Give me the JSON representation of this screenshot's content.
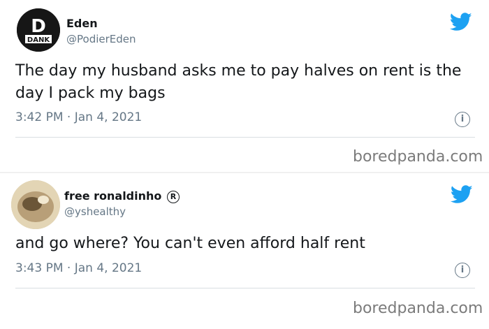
{
  "tweets": [
    {
      "display_name": "Eden",
      "handle": "@PodierEden",
      "avatar_logo": "D",
      "avatar_sub": "DANK",
      "text": "The day my husband asks me to pay halves on rent is the day I pack my bags",
      "timestamp": "3:42 PM · Jan 4, 2021",
      "watermark": "boredpanda.com"
    },
    {
      "display_name": "free ronaldinho",
      "handle": "@yshealthy",
      "text": "and go where? You can't even afford half rent",
      "timestamp": "3:43 PM · Jan 4, 2021",
      "watermark": "boredpanda.com"
    }
  ],
  "colors": {
    "twitter_blue": "#1da1f2",
    "secondary_text": "#657786",
    "primary_text": "#14171a"
  },
  "icons": [
    "twitter-bird-icon",
    "info-icon",
    "registered-icon"
  ]
}
